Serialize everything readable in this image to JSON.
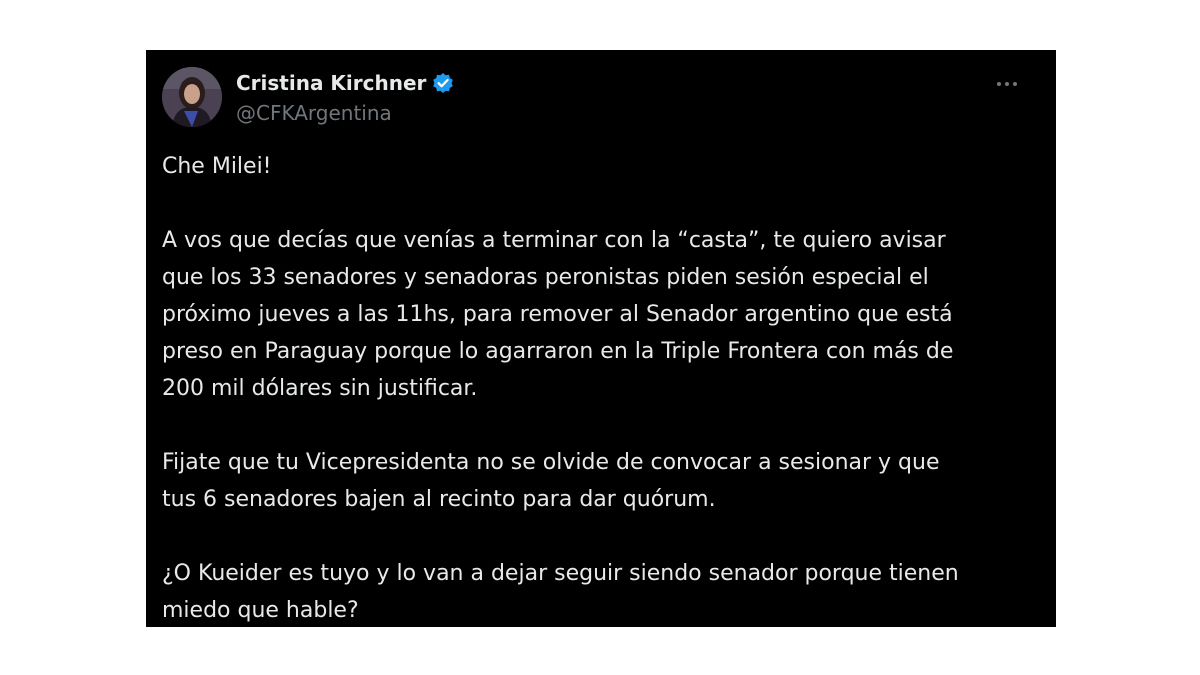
{
  "author": {
    "name": "Cristina Kirchner",
    "handle": "@CFKArgentina",
    "avatar_icon": "profile-photo",
    "verified_icon": "verified-badge-icon",
    "verified_color": "#1d9bf0"
  },
  "menu": {
    "more_icon": "more-options-icon"
  },
  "tweet": {
    "paragraphs": [
      "Che Milei!",
      "A vos que decías que venías a terminar con la “casta”, te quiero avisar\nque los 33 senadores y senadoras peronistas piden sesión especial el\npróximo jueves a las 11hs, para remover al Senador argentino que está\npreso en Paraguay porque lo agarraron en la Triple Frontera con más de\n200 mil dólares sin justificar.",
      "Fijate que tu Vicepresidenta no se olvide de convocar a sesionar y que\ntus 6 senadores bajen al recinto para dar quórum.",
      "¿O Kueider es tuyo y lo van a dejar seguir siendo senador porque tienen\nmiedo que hable?"
    ]
  },
  "colors": {
    "card_background": "#000000",
    "text_primary": "#e7e9ea",
    "text_secondary": "#71767b"
  }
}
